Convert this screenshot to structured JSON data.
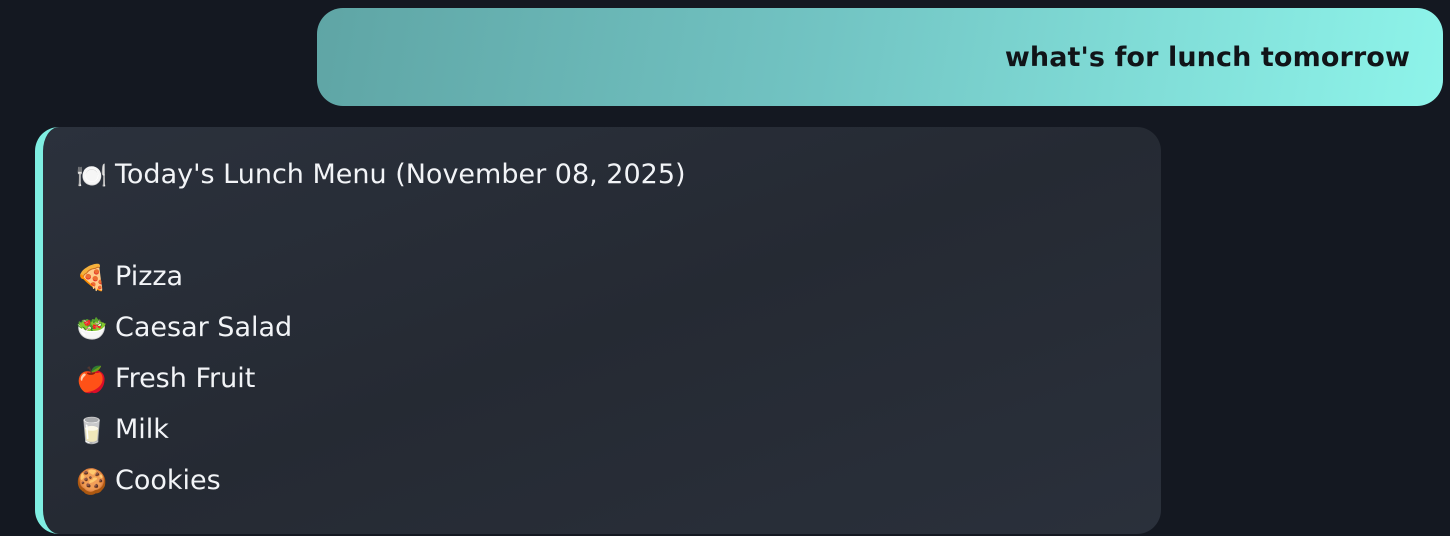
{
  "conversation": {
    "user_message": "what's for lunch tomorrow",
    "assistant_message": {
      "title": {
        "icon": "plate-cutlery-icon",
        "glyph": "🍽️",
        "text": "Today's Lunch Menu (November 08, 2025)"
      },
      "items": [
        {
          "icon": "pizza-icon",
          "glyph": "🍕",
          "label": "Pizza"
        },
        {
          "icon": "salad-icon",
          "glyph": "🥗",
          "label": "Caesar Salad"
        },
        {
          "icon": "apple-icon",
          "glyph": "🍎",
          "label": "Fresh Fruit"
        },
        {
          "icon": "milk-glass-icon",
          "glyph": "🥛",
          "label": "Milk"
        },
        {
          "icon": "cookie-icon",
          "glyph": "🍪",
          "label": "Cookies"
        }
      ]
    }
  },
  "colors": {
    "background": "#141821",
    "user_bubble_start": "#5fa5a5",
    "user_bubble_end": "#8ef4ea",
    "assistant_bubble": "#282d37",
    "assistant_accent_border": "#7feee2",
    "assistant_text": "#f2f4f7"
  }
}
